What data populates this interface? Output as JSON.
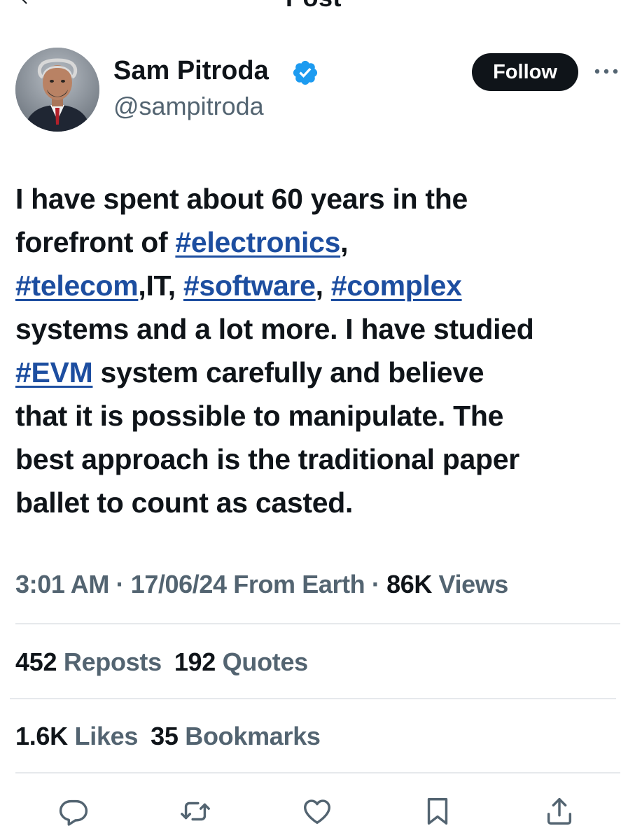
{
  "header": {
    "title": "Post"
  },
  "author": {
    "display_name": "Sam Pitroda",
    "handle": "@sampitroda",
    "follow_label": "Follow"
  },
  "tweet": {
    "line1": "I have spent about 60 years in the",
    "line2_text": "forefront of ",
    "line2_tag": "#electronics",
    "line2_tail": ",",
    "line3_tag1": "#telecom",
    "line3_mid1": ",IT, ",
    "line3_tag2": "#software",
    "line3_mid2": ", ",
    "line3_tag3": "#complex",
    "line4": "systems and a lot more. I have studied",
    "line5_tag": "#EVM",
    "line5_text": " system carefully and believe",
    "line6": "that it is possible to manipulate. The",
    "line7": "best approach is the traditional paper",
    "line8": "ballet to count as casted."
  },
  "meta": {
    "time": "3:01 AM",
    "sep1": " · ",
    "date": "17/06/24",
    "source": " From Earth",
    "sep2": " · ",
    "views_count": "86K",
    "views_label": " Views"
  },
  "stats": {
    "reposts_count": "452",
    "reposts_label": " Reposts",
    "quotes_count": "192",
    "quotes_label": " Quotes",
    "likes_count": "1.6K",
    "likes_label": " Likes",
    "bookmarks_count": "35",
    "bookmarks_label": " Bookmarks"
  },
  "actions": [
    {
      "icon": "reply-icon"
    },
    {
      "icon": "repost-icon"
    },
    {
      "icon": "like-icon"
    },
    {
      "icon": "bookmark-icon"
    },
    {
      "icon": "share-icon"
    }
  ],
  "colors": {
    "text": "#0f1419",
    "muted": "#536471",
    "link": "#1d4ea0",
    "verified": "#1d9bf0",
    "divider": "#e6e9ec"
  }
}
